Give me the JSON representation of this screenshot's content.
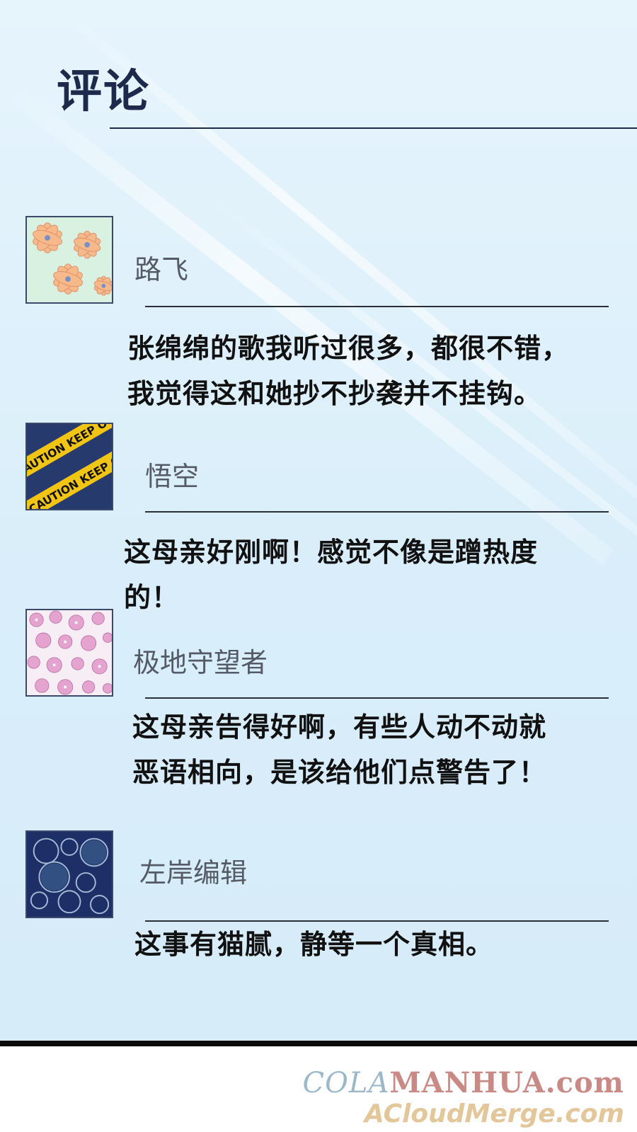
{
  "header": {
    "title": "评论"
  },
  "comments": [
    {
      "avatar_icon": "orange-flower-pattern-avatar",
      "author": "路飞",
      "text_lines": [
        "张绵绵的歌我听过很多，都很不错，",
        "我觉得这和她抄不抄袭并不挂钩。"
      ]
    },
    {
      "avatar_icon": "caution-tape-avatar",
      "author": "悟空",
      "text_lines": [
        "这母亲好刚啊！感觉不像是蹭热度",
        "的！"
      ]
    },
    {
      "avatar_icon": "pink-blossom-pattern-avatar",
      "author": "极地守望者",
      "text_lines": [
        "这母亲告得好啊，有些人动不动就",
        "恶语相向，是该给他们点警告了！"
      ]
    },
    {
      "avatar_icon": "bubbles-avatar",
      "author": "左岸编辑",
      "text_lines": [
        "这事有猫腻，静等一个真相。"
      ]
    }
  ],
  "avatar_text": {
    "caution_tape": "CAUTION KEEP OUT"
  },
  "watermark": {
    "line1_part1": "COLA",
    "line1_part2": "MANHUA.com",
    "line2": "ACloudMerge.com"
  },
  "colors": {
    "title": "#1d2a4c",
    "panel": "#e3f2fb",
    "divider": "#2a2f38"
  }
}
